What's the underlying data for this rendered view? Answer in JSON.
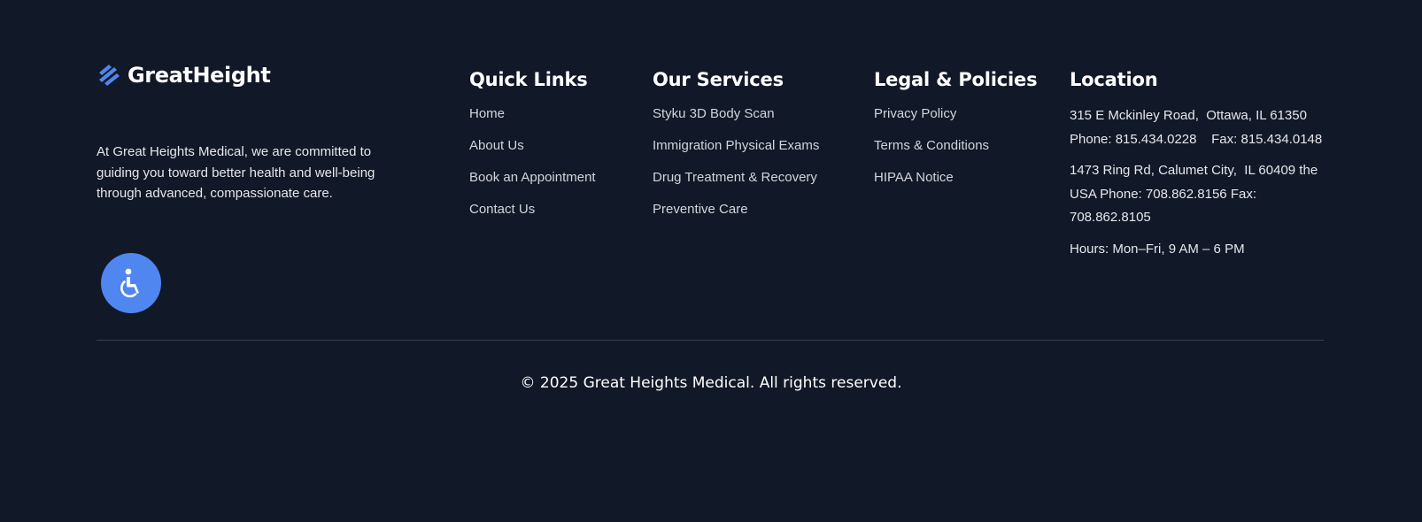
{
  "brand": {
    "name": "GreatHeight",
    "logo_icon": "stacked-chevrons-icon",
    "accent_color": "#4f86ef",
    "description": "At Great Heights Medical, we are committed to guiding you toward better health and well-being through advanced, compassionate care."
  },
  "quick_links": {
    "heading": "Quick Links",
    "items": [
      {
        "label": "Home"
      },
      {
        "label": "About Us"
      },
      {
        "label": "Book an Appointment"
      },
      {
        "label": "Contact Us"
      }
    ]
  },
  "services": {
    "heading": "Our Services",
    "items": [
      {
        "label": "Styku 3D Body Scan"
      },
      {
        "label": "Immigration Physical Exams"
      },
      {
        "label": "Drug Treatment & Recovery"
      },
      {
        "label": "Preventive Care"
      }
    ]
  },
  "legal": {
    "heading": "Legal & Policies",
    "items": [
      {
        "label": "Privacy Policy"
      },
      {
        "label": "Terms & Conditions"
      },
      {
        "label": "HIPAA Notice"
      }
    ]
  },
  "location": {
    "heading": "Location",
    "blocks": [
      {
        "text": "315 E Mckinley Road,  Ottawa, IL 61350 Phone: 815.434.0228    Fax: 815.434.0148"
      },
      {
        "text": "1473 Ring Rd, Calumet City,  IL 60409 the USA Phone: 708.862.8156 Fax: 708.862.8105"
      },
      {
        "text": "Hours: Mon–Fri, 9 AM – 6 PM"
      }
    ]
  },
  "accessibility": {
    "icon": "wheelchair-icon",
    "color": "#4f86ef"
  },
  "footer": {
    "copyright": "© 2025 Great Heights Medical. All rights reserved."
  }
}
